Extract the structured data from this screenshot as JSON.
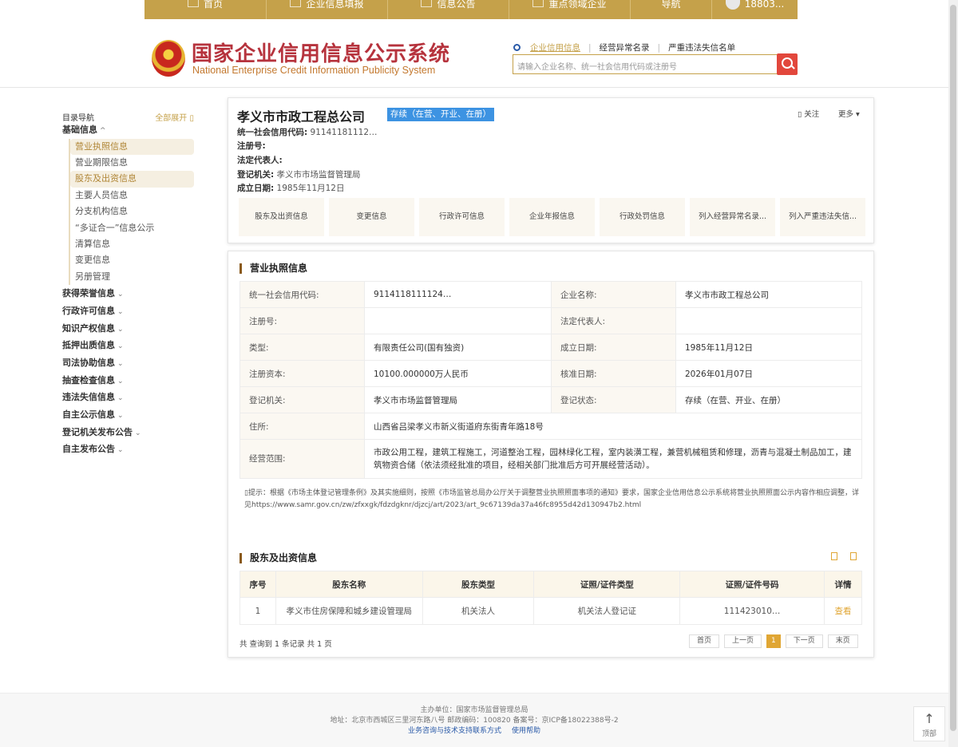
{
  "nav": {
    "items": [
      {
        "label": "首页",
        "icon": "monitor-icon"
      },
      {
        "label": "企业信息填报",
        "icon": "edit-icon"
      },
      {
        "label": "信息公告",
        "icon": "document-icon"
      },
      {
        "label": "重点领域企业",
        "icon": "speaker-icon"
      },
      {
        "label": "导航",
        "icon": ""
      }
    ],
    "user": "18803..."
  },
  "header": {
    "title": "国家企业信用信息公示系统",
    "subtitle": "National Enterprise Credit Information Publicity System",
    "search_links": [
      "企业信用信息",
      "经营异常名录",
      "严重违法失信名单"
    ],
    "search_placeholder": "请输入企业名称、统一社会信用代码或注册号"
  },
  "sidebar": {
    "nav_label": "目录导航",
    "expand_all": "全部展开 ▯",
    "basic_group": "基础信息",
    "basic_items": [
      "营业执照信息",
      "营业期限信息",
      "股东及出资信息",
      "主要人员信息",
      "分支机构信息",
      "“多证合一”信息公示",
      "清算信息",
      "变更信息",
      "另册管理"
    ],
    "groups": [
      "获得荣誉信息",
      "行政许可信息",
      "知识产权信息",
      "抵押出质信息",
      "司法协助信息",
      "抽查检查信息",
      "违法失信信息",
      "自主公示信息",
      "登记机关发布公告",
      "自主发布公告"
    ]
  },
  "company": {
    "name": "孝义市市政工程总公司",
    "status": "存续（在营、开业、在册）",
    "credit_code_label": "统一社会信用代码:",
    "credit_code": "91141181112…",
    "reg_no_label": "注册号:",
    "legal_rep_label": "法定代表人:",
    "authority_label": "登记机关:",
    "authority": "孝义市市场监督管理局",
    "found_label": "成立日期:",
    "found": "1985年11月12日",
    "follow": "▯ 关注",
    "more": "更多 ▾",
    "tabs": [
      "股东及出资信息",
      "变更信息",
      "行政许可信息",
      "企业年报信息",
      "行政处罚信息",
      "列入经营异常名录...",
      "列入严重违法失信..."
    ]
  },
  "license": {
    "title": "营业执照信息",
    "rows": [
      [
        "统一社会信用代码:",
        "9114118111124…",
        "企业名称:",
        "孝义市市政工程总公司"
      ],
      [
        "注册号:",
        "",
        "法定代表人:",
        ""
      ],
      [
        "类型:",
        "有限责任公司(国有独资)",
        "成立日期:",
        "1985年11月12日"
      ],
      [
        "注册资本:",
        "10100.000000万人民币",
        "核准日期:",
        "2026年01月07日"
      ],
      [
        "登记机关:",
        "孝义市市场监督管理局",
        "登记状态:",
        "存续（在营、开业、在册）"
      ]
    ],
    "address_label": "住所:",
    "address": "山西省吕梁孝义市新义街道府东街青年路18号",
    "scope_label": "经营范围:",
    "scope": "市政公用工程，建筑工程施工，河道整治工程，园林绿化工程，室内装潢工程，兼营机械租赁和修理，沥青与混凝土制品加工，建筑物资合储（依法须经批准的项目，经相关部门批准后方可开展经营活动）。",
    "notice": "▯提示：根据《市场主体登记管理条例》及其实施细则，按照《市场监管总局办公厅关于调整营业执照照面事项的通知》要求，国家企业信用信息公示系统将营业执照照面公示内容作相应调整，详见https://www.samr.gov.cn/zw/zfxxgk/fdzdgknr/djzcj/art/2023/art_9c67139da37a46fc8955d42d130947b2.html"
  },
  "shareholders": {
    "title": "股东及出资信息",
    "headers": [
      "序号",
      "股东名称",
      "股东类型",
      "证照/证件类型",
      "证照/证件号码",
      "详情"
    ],
    "rows": [
      [
        "1",
        "孝义市住房保障和城乡建设管理局",
        "机关法人",
        "机关法人登记证",
        "111423010…",
        "查看"
      ]
    ],
    "summary": "共 查询到 1 条记录 共 1 页",
    "pager": [
      "首页",
      "上一页",
      "1",
      "下一页",
      "末页"
    ]
  },
  "footer": {
    "line1": "主办单位：国家市场监督管理总局",
    "line2": "地址：北京市西城区三里河东路八号   邮政编码：100820   备案号：京ICP备18022388号-2",
    "link1": "业务咨询与技术支持联系方式",
    "link2": "使用帮助",
    "to_top": "顶部"
  }
}
